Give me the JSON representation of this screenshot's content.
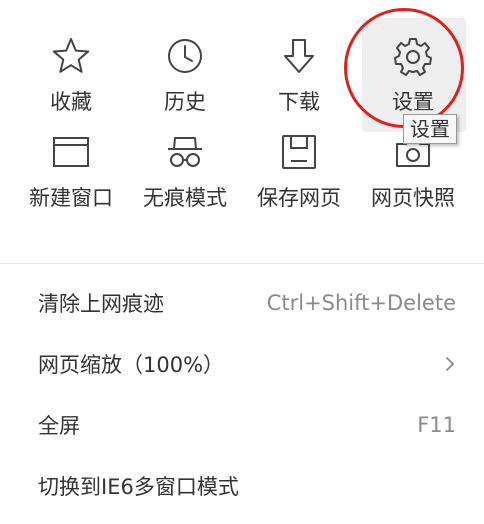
{
  "grid": [
    {
      "id": "favorites",
      "label": "收藏",
      "icon": "star-icon"
    },
    {
      "id": "history",
      "label": "历史",
      "icon": "clock-icon"
    },
    {
      "id": "downloads",
      "label": "下载",
      "icon": "download-arrow-icon"
    },
    {
      "id": "settings",
      "label": "设置",
      "icon": "gear-icon"
    },
    {
      "id": "new-window",
      "label": "新建窗口",
      "icon": "window-icon"
    },
    {
      "id": "incognito",
      "label": "无痕模式",
      "icon": "incognito-glasses-icon"
    },
    {
      "id": "save-page",
      "label": "保存网页",
      "icon": "floppy-disk-icon"
    },
    {
      "id": "screenshot",
      "label": "网页快照",
      "icon": "camera-icon"
    }
  ],
  "tooltip": "设置",
  "menu": [
    {
      "label": "清除上网痕迹",
      "right": "Ctrl+Shift+Delete"
    },
    {
      "label": "网页缩放（100%）",
      "right_icon": "chevron-right-icon"
    },
    {
      "label": "全屏",
      "right": "F11"
    },
    {
      "label": "切换到IE6多窗口模式"
    }
  ],
  "colors": {
    "icon": "#444444",
    "text": "#333333",
    "shortcut": "#8a8a8a",
    "highlight": "#eeeeee",
    "annotation_red": "#e02020",
    "divider": "#e6e6e6"
  }
}
